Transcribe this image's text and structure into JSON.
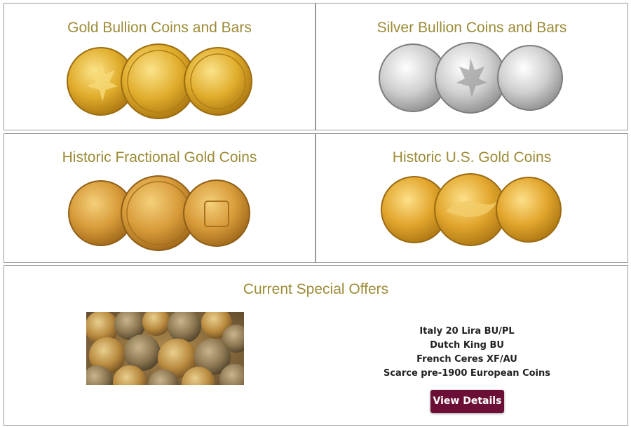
{
  "categories": [
    {
      "title": "Gold Bullion Coins and Bars",
      "coins": [
        "gold-maple-leaf-coin",
        "gold-eagle-coin",
        "krugerrand-coin"
      ]
    },
    {
      "title": "Silver Bullion Coins and Bars",
      "coins": [
        "silver-eagle-coin",
        "silver-maple-leaf-coin",
        "silver-philharmonic-coin"
      ]
    },
    {
      "title": "Historic Fractional Gold Coins",
      "coins": [
        "gold-sovereign-coin",
        "helvetia-vreneli-coin",
        "netherlands-gold-coin"
      ]
    },
    {
      "title": "Historic U.S. Gold Coins",
      "coins": [
        "liberty-head-gold-coin",
        "saint-gaudens-eagle-reverse-coin",
        "saint-gaudens-liberty-coin"
      ]
    }
  ],
  "offers": {
    "title": "Current Special Offers",
    "items": [
      "Italy 20 Lira BU/PL",
      "Dutch King BU",
      "French Ceres XF/AU",
      "Scarce pre-1900 European Coins"
    ],
    "button_label": "View Details"
  },
  "colors": {
    "title": "#9c8b36",
    "button": "#6b0f36",
    "gold": "#d9a62a",
    "silver": "#c9c9c9"
  }
}
